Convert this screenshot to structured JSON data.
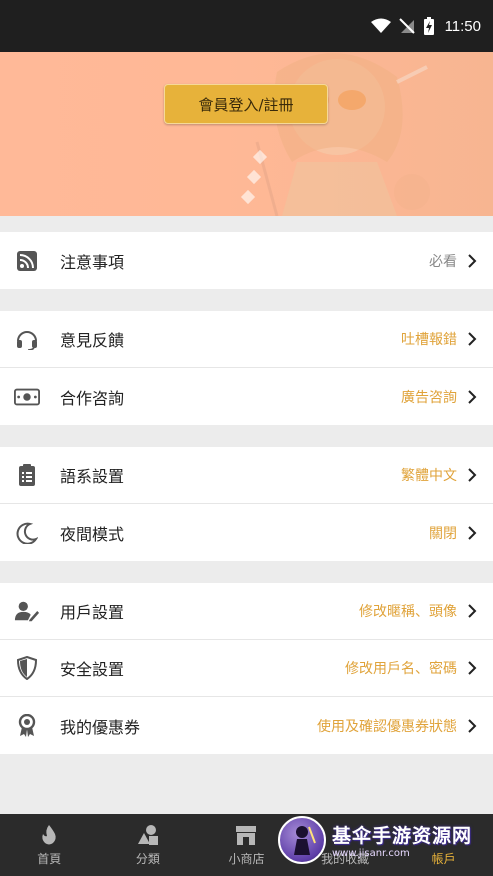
{
  "status_bar": {
    "time": "11:50"
  },
  "banner": {
    "login_label": "會員登入/註冊"
  },
  "sections": [
    [
      {
        "label": "注意事項",
        "hint": "必看",
        "icon": "rss-icon",
        "hint_style": "gray"
      }
    ],
    [
      {
        "label": "意見反饋",
        "hint": "吐槽報錯",
        "icon": "headset-icon"
      },
      {
        "label": "合作咨詢",
        "hint": "廣告咨詢",
        "icon": "money-icon"
      }
    ],
    [
      {
        "label": "語系設置",
        "hint": "繁體中文",
        "icon": "clipboard-icon"
      },
      {
        "label": "夜間模式",
        "hint": "關閉",
        "icon": "moon-icon"
      }
    ],
    [
      {
        "label": "用戶設置",
        "hint": "修改暱稱、頭像",
        "icon": "user-edit-icon"
      },
      {
        "label": "安全設置",
        "hint": "修改用戶名、密碼",
        "icon": "shield-icon"
      },
      {
        "label": "我的優惠券",
        "hint": "使用及確認優惠券狀態",
        "icon": "award-icon"
      }
    ]
  ],
  "tabbar": {
    "items": [
      {
        "label": "首頁",
        "icon": "flame-icon"
      },
      {
        "label": "分類",
        "icon": "shapes-icon"
      },
      {
        "label": "小商店",
        "icon": "store-icon"
      },
      {
        "label": "我的收藏",
        "icon": "favorites-icon"
      },
      {
        "label": "帳戶",
        "icon": "account-icon",
        "active": true
      }
    ]
  },
  "watermark": {
    "title": "基伞手游资源网",
    "subtitle": "www.jisanr.com"
  },
  "colors": {
    "accent": "#e7b23a",
    "banner": "#ffb998",
    "status_bar": "#1f1f1f",
    "tabbar": "#2b2b2b"
  }
}
